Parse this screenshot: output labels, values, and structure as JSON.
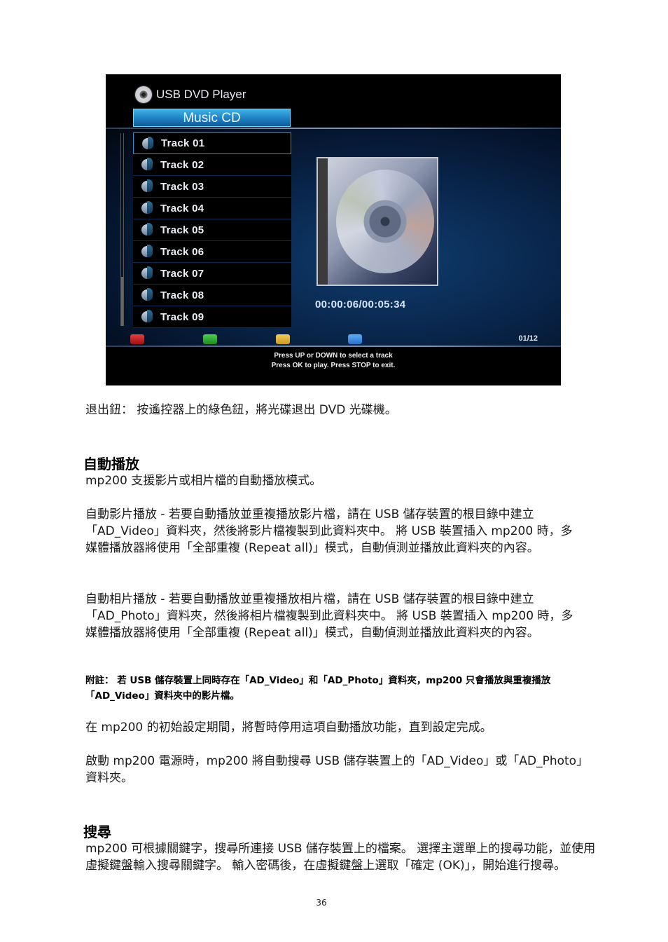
{
  "tv_screen": {
    "app_title": "USB DVD Player",
    "section_title": "Music CD",
    "tracks": [
      {
        "label": "Track 01",
        "selected": true
      },
      {
        "label": "Track 02",
        "selected": false
      },
      {
        "label": "Track 03",
        "selected": false
      },
      {
        "label": "Track 04",
        "selected": false
      },
      {
        "label": "Track 05",
        "selected": false
      },
      {
        "label": "Track 06",
        "selected": false
      },
      {
        "label": "Track 07",
        "selected": false
      },
      {
        "label": "Track 08",
        "selected": false
      },
      {
        "label": "Track 09",
        "selected": false
      }
    ],
    "playback_time": "00:00:06/00:05:34",
    "page_indicator": "01/12",
    "color_keys": [
      {
        "name": "red",
        "color": "#c42020"
      },
      {
        "name": "green",
        "color": "#2fae2f"
      },
      {
        "name": "yellow",
        "color": "#e0b440"
      },
      {
        "name": "blue",
        "color": "#3f8fe0"
      }
    ],
    "hint_line1": "Press UP or DOWN to select a track",
    "hint_line2": "Press OK to play. Press STOP to exit.",
    "accent_color": "#2a8fd0"
  },
  "document": {
    "eject_text": "退出鈕： 按遙控器上的綠色鈕，將光碟退出 DVD 光碟機。",
    "autoplay_heading": "自動播放",
    "autoplay_intro": "mp200 支援影片或相片檔的自動播放模式。",
    "auto_video": "自動影片播放 - 若要自動播放並重複播放影片檔，請在 USB 儲存裝置的根目錄中建立「AD_Video」資料夾，然後將影片檔複製到此資料夾中。 將 USB 裝置插入 mp200 時，多媒體播放器將使用「全部重複 (Repeat all)」模式，自動偵測並播放此資料夾的內容。",
    "auto_photo": "自動相片播放 - 若要自動播放並重複播放相片檔，請在 USB 儲存裝置的根目錄中建立「AD_Photo」資料夾，然後將相片檔複製到此資料夾中。 將 USB 裝置插入 mp200 時，多媒體播放器將使用「全部重複 (Repeat all)」模式，自動偵測並播放此資料夾的內容。",
    "note": "附註： 若 USB 儲存裝置上同時存在「AD_Video」和「AD_Photo」資料夾，mp200 只會播放與重複播放「AD_Video」資料夾中的影片檔。",
    "setup_text": "在 mp200 的初始設定期間，將暫時停用這項自動播放功能，直到設定完成。",
    "poweron_text": "啟動 mp200 電源時，mp200 將自動搜尋 USB 儲存裝置上的「AD_Video」或「AD_Photo」資料夾。",
    "search_heading": "搜尋",
    "search_text": "mp200 可根據關鍵字，搜尋所連接 USB 儲存裝置上的檔案。 選擇主選單上的搜尋功能，並使用虛擬鍵盤輸入搜尋關鍵字。 輸入密碼後，在虛擬鍵盤上選取「確定 (OK)」，開始進行搜尋。",
    "page_number": "36"
  }
}
